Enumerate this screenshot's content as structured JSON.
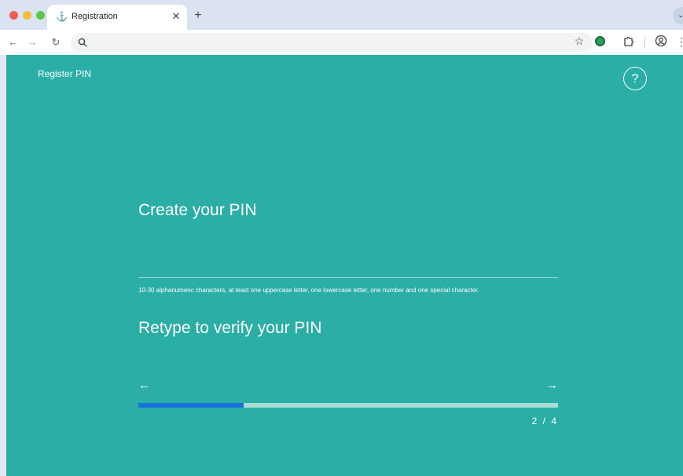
{
  "browser": {
    "tab": {
      "title": "Registration"
    },
    "omnibox": {
      "value": "",
      "placeholder": ""
    }
  },
  "page": {
    "header_title": "Register PIN",
    "help_label": "?",
    "pin_label": "Create your PIN",
    "pin_value": "",
    "pin_hint": "10-30 alphanumeric characters, at least one uppercase letter, one lowercase letter, one number and one special character.",
    "verify_label": "Retype to verify your PIN",
    "verify_value": "",
    "prev_arrow": "←",
    "next_arrow": "→",
    "step_counter": "2 / 4",
    "progress_fraction": 0.25
  },
  "colors": {
    "background": "#2aaea5",
    "progress_fill": "#1a73d9",
    "progress_track": "#a8dcd7"
  },
  "icons": [
    "back-arrow-icon",
    "forward-arrow-icon",
    "reload-icon",
    "search-icon",
    "star-icon",
    "extension-icon",
    "puzzle-icon",
    "profile-icon",
    "menu-icon",
    "help-icon",
    "close-icon",
    "plus-icon"
  ]
}
